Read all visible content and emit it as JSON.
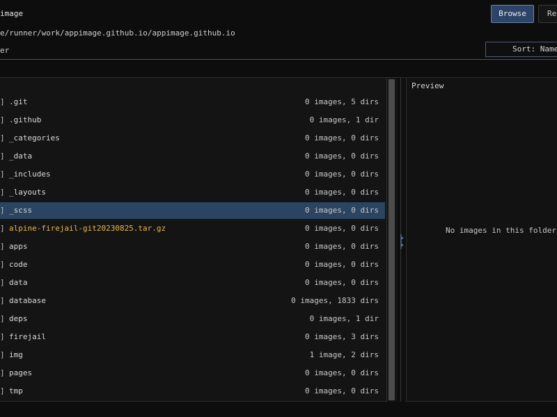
{
  "header": {
    "title": "image",
    "path": "e/runner/work/appimage.github.io/appimage.github.io",
    "filter_label": "er",
    "browse_label": "Browse",
    "recent_label": "Rec",
    "sort_label": "Sort: Name"
  },
  "list": {
    "rows": [
      {
        "marker": "]",
        "name": ".git",
        "count": "0 images, 5 dirs",
        "type": "dir"
      },
      {
        "marker": "]",
        "name": ".github",
        "count": "0 images, 1 dir",
        "type": "dir"
      },
      {
        "marker": "]",
        "name": "_categories",
        "count": "0 images, 0 dirs",
        "type": "dir"
      },
      {
        "marker": "]",
        "name": "_data",
        "count": "0 images, 0 dirs",
        "type": "dir"
      },
      {
        "marker": "]",
        "name": "_includes",
        "count": "0 images, 0 dirs",
        "type": "dir"
      },
      {
        "marker": "]",
        "name": "_layouts",
        "count": "0 images, 0 dirs",
        "type": "dir"
      },
      {
        "marker": "]",
        "name": "_scss",
        "count": "0 images, 0 dirs",
        "type": "dir",
        "selected": true
      },
      {
        "marker": "]",
        "name": "alpine-firejail-git20230825.tar.gz",
        "count": "0 images, 0 dirs",
        "type": "file"
      },
      {
        "marker": "]",
        "name": "apps",
        "count": "0 images, 0 dirs",
        "type": "dir"
      },
      {
        "marker": "]",
        "name": "code",
        "count": "0 images, 0 dirs",
        "type": "dir"
      },
      {
        "marker": "]",
        "name": "data",
        "count": "0 images, 0 dirs",
        "type": "dir"
      },
      {
        "marker": "]",
        "name": "database",
        "count": "0 images, 1833 dirs",
        "type": "dir"
      },
      {
        "marker": "]",
        "name": "deps",
        "count": "0 images, 1 dir",
        "type": "dir"
      },
      {
        "marker": "]",
        "name": "firejail",
        "count": "0 images, 3 dirs",
        "type": "dir"
      },
      {
        "marker": "]",
        "name": "img",
        "count": "1 image, 2 dirs",
        "type": "dir"
      },
      {
        "marker": "]",
        "name": "pages",
        "count": "0 images, 0 dirs",
        "type": "dir"
      },
      {
        "marker": "]",
        "name": "tmp",
        "count": "0 images, 0 dirs",
        "type": "dir"
      }
    ]
  },
  "preview": {
    "title": "Preview",
    "empty_message": "No images in this folder"
  },
  "colors": {
    "selected_row": "#2a4461",
    "file_name": "#e8b84a",
    "browse_button": "#2b4468",
    "accent_border": "#4e5a72"
  }
}
